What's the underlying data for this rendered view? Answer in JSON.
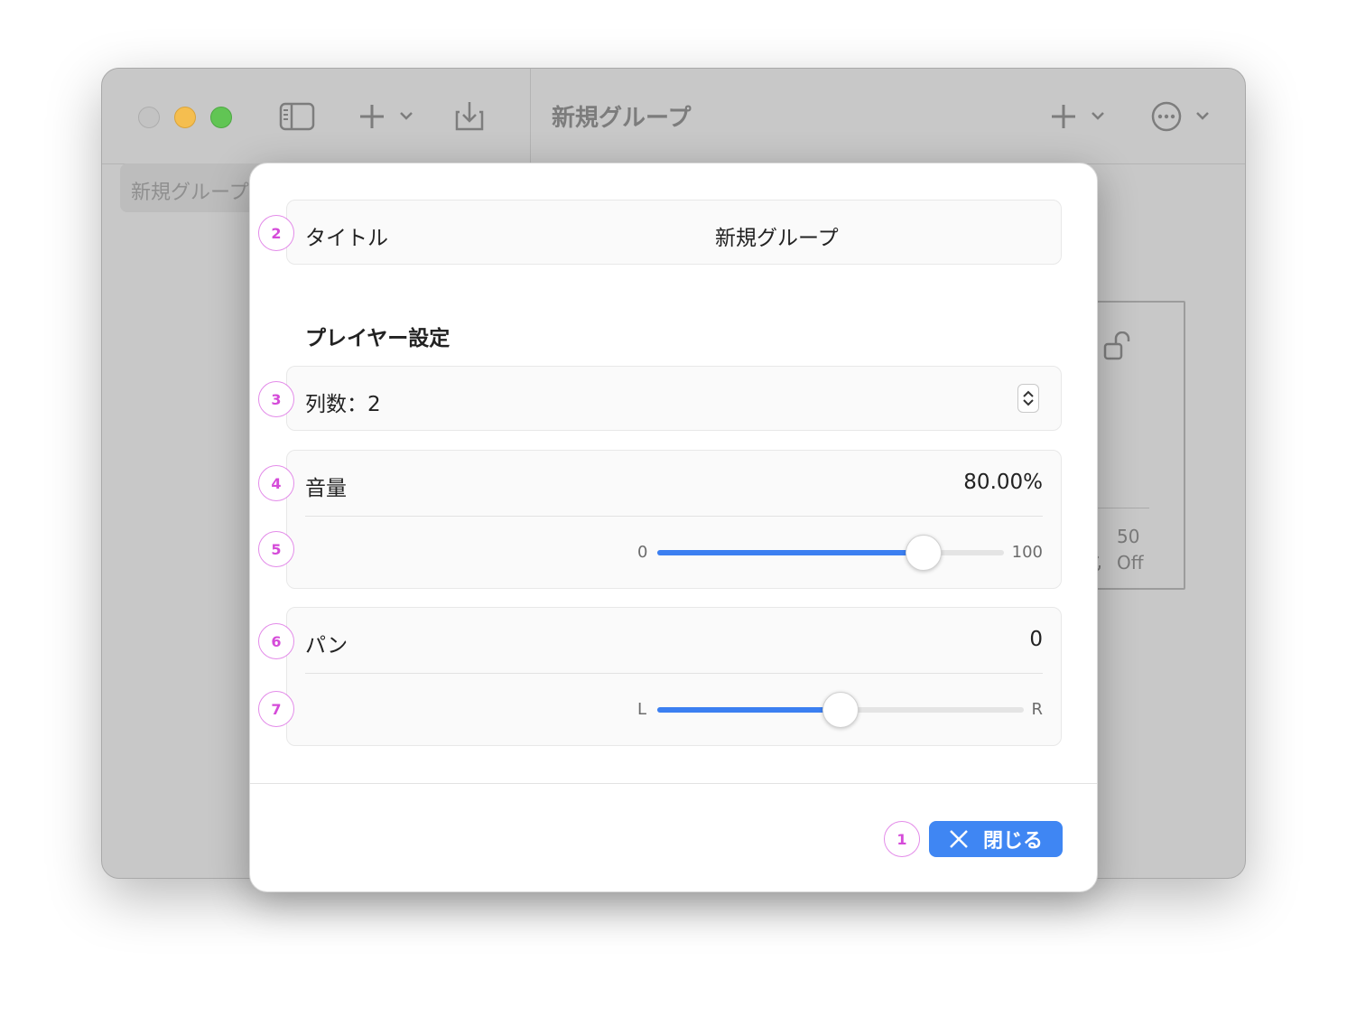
{
  "window": {
    "title": "新規グループ",
    "sidebar_item": "新規グループ",
    "card": {
      "volume": "50",
      "repeat": "Off"
    }
  },
  "dialog": {
    "title_row": {
      "label": "タイトル",
      "value": "新規グループ",
      "badge": "2"
    },
    "section_title": "プレイヤー設定",
    "columns": {
      "label": "列数：2",
      "badge": "3"
    },
    "volume": {
      "label": "音量",
      "value": "80.00%",
      "badge": "4"
    },
    "volume_slider": {
      "min_label": "0",
      "max_label": "100",
      "level": 0.8,
      "badge": "5"
    },
    "pan": {
      "label": "パン",
      "value": "0",
      "badge": "6"
    },
    "pan_slider": {
      "min_label": "L",
      "max_label": "R",
      "level": 0.5,
      "badge": "7"
    },
    "close_button": {
      "label": "閉じる",
      "icon": "close-icon",
      "badge": "1"
    }
  },
  "colors": {
    "accent": "#3f86f3",
    "badge": "#d54bd9"
  }
}
